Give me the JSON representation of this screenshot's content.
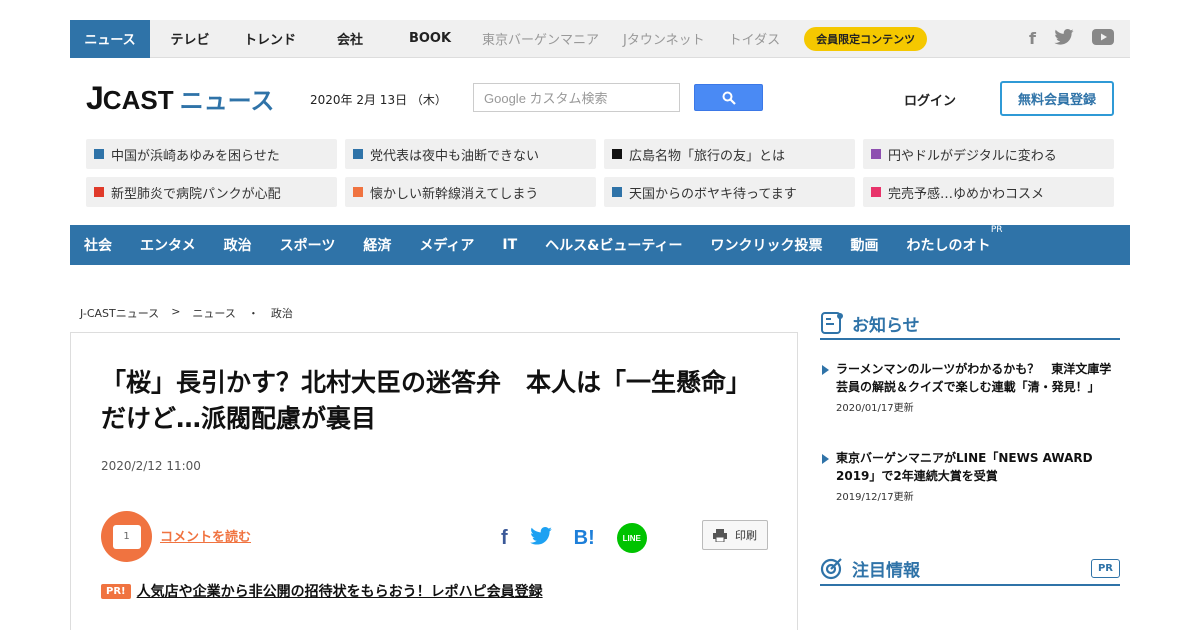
{
  "topnav": {
    "items": [
      "ニュース",
      "テレビ",
      "トレンド",
      "会社",
      "BOOK"
    ],
    "partners": [
      "東京バーゲンマニア",
      "Jタウンネット",
      "トイダス"
    ],
    "members_badge": "会員限定コンテンツ",
    "social": [
      "f",
      "t",
      "▶"
    ]
  },
  "header": {
    "logo_j": "J",
    "logo_cast": "CAST",
    "logo_news": "ニュース",
    "date": "2020年 2月 13日 （木）",
    "search_placeholder": "Google カスタム検索",
    "login": "ログイン",
    "register": "無料会員登録"
  },
  "adlinks": [
    {
      "text": "中国が浜崎あゆみを困らせた",
      "color": "#2f73a8"
    },
    {
      "text": "党代表は夜中も油断できない",
      "color": "#2f73a8"
    },
    {
      "text": "広島名物「旅行の友」とは",
      "color": "#111111"
    },
    {
      "text": "円やドルがデジタルに変わる",
      "color": "#8e4fb0"
    },
    {
      "text": "新型肺炎で病院パンクが心配",
      "color": "#e03a2a"
    },
    {
      "text": "懐かしい新幹線消えてしまう",
      "color": "#f07340"
    },
    {
      "text": "天国からのボヤキ待ってます",
      "color": "#2f73a8"
    },
    {
      "text": "完売予感…ゆめかわコスメ",
      "color": "#e8336a"
    }
  ],
  "catnav": {
    "items": [
      "社会",
      "エンタメ",
      "政治",
      "スポーツ",
      "経済",
      "メディア",
      "IT",
      "ヘルス&ビューティー",
      "ワンクリック投票",
      "動画",
      "わたしのオト"
    ],
    "pr": "PR"
  },
  "breadcrumb": [
    "J-CASTニュース",
    ">",
    "ニュース",
    "・",
    "政治"
  ],
  "article": {
    "title": "「桜」長引かす？北村大臣の迷答弁　本人は「一生懸命」だけど…派閥配慮が裏目",
    "date": "2020/2/12 11:00",
    "comment_count": "1",
    "comment_link": "コメントを読む",
    "share": [
      "f",
      "t",
      "B!",
      "LINE"
    ],
    "print": "印刷",
    "pr_tag": "PR!",
    "pr_link": "人気店や企業から非公開の招待状をもらおう！レポハピ会員登録"
  },
  "sidebar": {
    "notice_title": "お知らせ",
    "notices": [
      {
        "text": "ラーメンマンのルーツがわかるかも？　東洋文庫学芸員の解説＆クイズで楽しむ連載「清・発見！」",
        "updated": "2020/01/17更新"
      },
      {
        "text": "東京バーゲンマニアがLINE「NEWS AWARD 2019」で2年連続大賞を受賞",
        "updated": "2019/12/17更新"
      }
    ],
    "attention_title": "注目情報",
    "attention_pr": "PR"
  }
}
